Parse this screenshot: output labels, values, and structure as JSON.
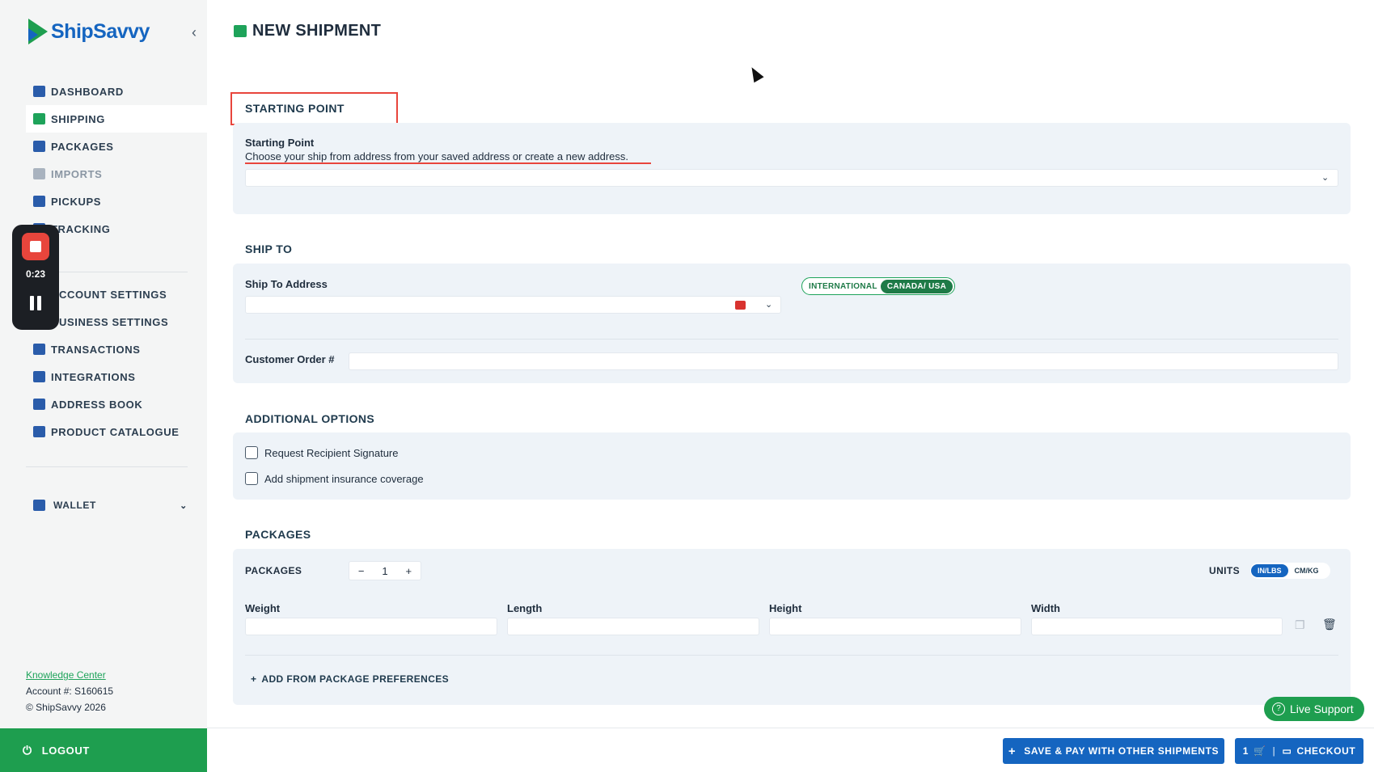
{
  "app": {
    "logo_text": "ShipSavvy"
  },
  "sidebar": {
    "items": [
      {
        "label": "DASHBOARD",
        "icon": "home-icon"
      },
      {
        "label": "SHIPPING",
        "icon": "box-icon"
      },
      {
        "label": "PACKAGES",
        "icon": "packages-icon"
      },
      {
        "label": "IMPORTS",
        "icon": "import-icon"
      },
      {
        "label": "PICKUPS",
        "icon": "pickup-icon"
      },
      {
        "label": "TRACKING",
        "icon": "tracking-icon"
      },
      {
        "label": "ACCOUNT SETTINGS",
        "icon": "account-icon"
      },
      {
        "label": "BUSINESS SETTINGS",
        "icon": "business-icon"
      },
      {
        "label": "TRANSACTIONS",
        "icon": "document-icon"
      },
      {
        "label": "INTEGRATIONS",
        "icon": "store-icon"
      },
      {
        "label": "ADDRESS BOOK",
        "icon": "address-book-icon"
      },
      {
        "label": "PRODUCT CATALOGUE",
        "icon": "catalogue-icon"
      }
    ],
    "wallet_label": "WALLET",
    "knowledge_center": "Knowledge Center",
    "account": "Account #: S160615",
    "copyright": "© ShipSavvy 2026",
    "logout": "LOGOUT"
  },
  "recorder": {
    "time": "0:23"
  },
  "page": {
    "title": "NEW SHIPMENT"
  },
  "starting_point": {
    "heading": "STARTING POINT",
    "label": "Starting Point",
    "help": "Choose your ship from address from your saved address or create a new address."
  },
  "ship_to": {
    "heading": "SHIP TO",
    "address_label": "Ship To Address",
    "toggle": [
      "INTERNATIONAL",
      "CANADA/ USA"
    ],
    "order_label": "Customer Order #"
  },
  "additional_options": {
    "heading": "ADDITIONAL OPTIONS",
    "options": [
      "Request Recipient Signature",
      "Add shipment insurance coverage"
    ]
  },
  "packages": {
    "heading": "PACKAGES",
    "count_label": "PACKAGES",
    "count": "1",
    "minus": "−",
    "plus": "+",
    "units_label": "UNITS",
    "units": [
      "IN/LBS",
      "CM/KG"
    ],
    "fields": [
      "Weight",
      "Length",
      "Height",
      "Width"
    ],
    "add_pref": "ADD FROM PACKAGE PREFERENCES"
  },
  "footer": {
    "live_support": "Live Support",
    "save_pay": "SAVE & PAY WITH OTHER SHIPMENTS",
    "cart_count": "1",
    "checkout": "CHECKOUT"
  }
}
